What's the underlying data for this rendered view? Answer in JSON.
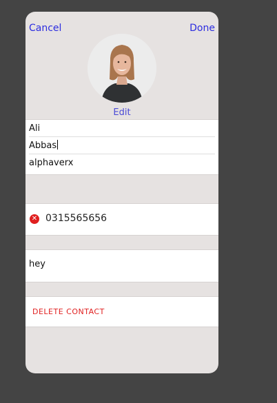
{
  "header": {
    "cancel_label": "Cancel",
    "done_label": "Done"
  },
  "profile": {
    "avatar_icon": "person-photo-icon",
    "edit_label": "Edit"
  },
  "fields": {
    "first_name": "Ali",
    "last_name": "Abbas",
    "company": "alphaverx"
  },
  "phone": {
    "icon": "remove-circle-icon",
    "number": "0315565656"
  },
  "notes": {
    "text": "hey"
  },
  "actions": {
    "delete_label": "DELETE CONTACT"
  },
  "colors": {
    "background": "#444444",
    "panel": "#e6e2e1",
    "link": "#2c2ce0",
    "danger": "#e02020"
  }
}
